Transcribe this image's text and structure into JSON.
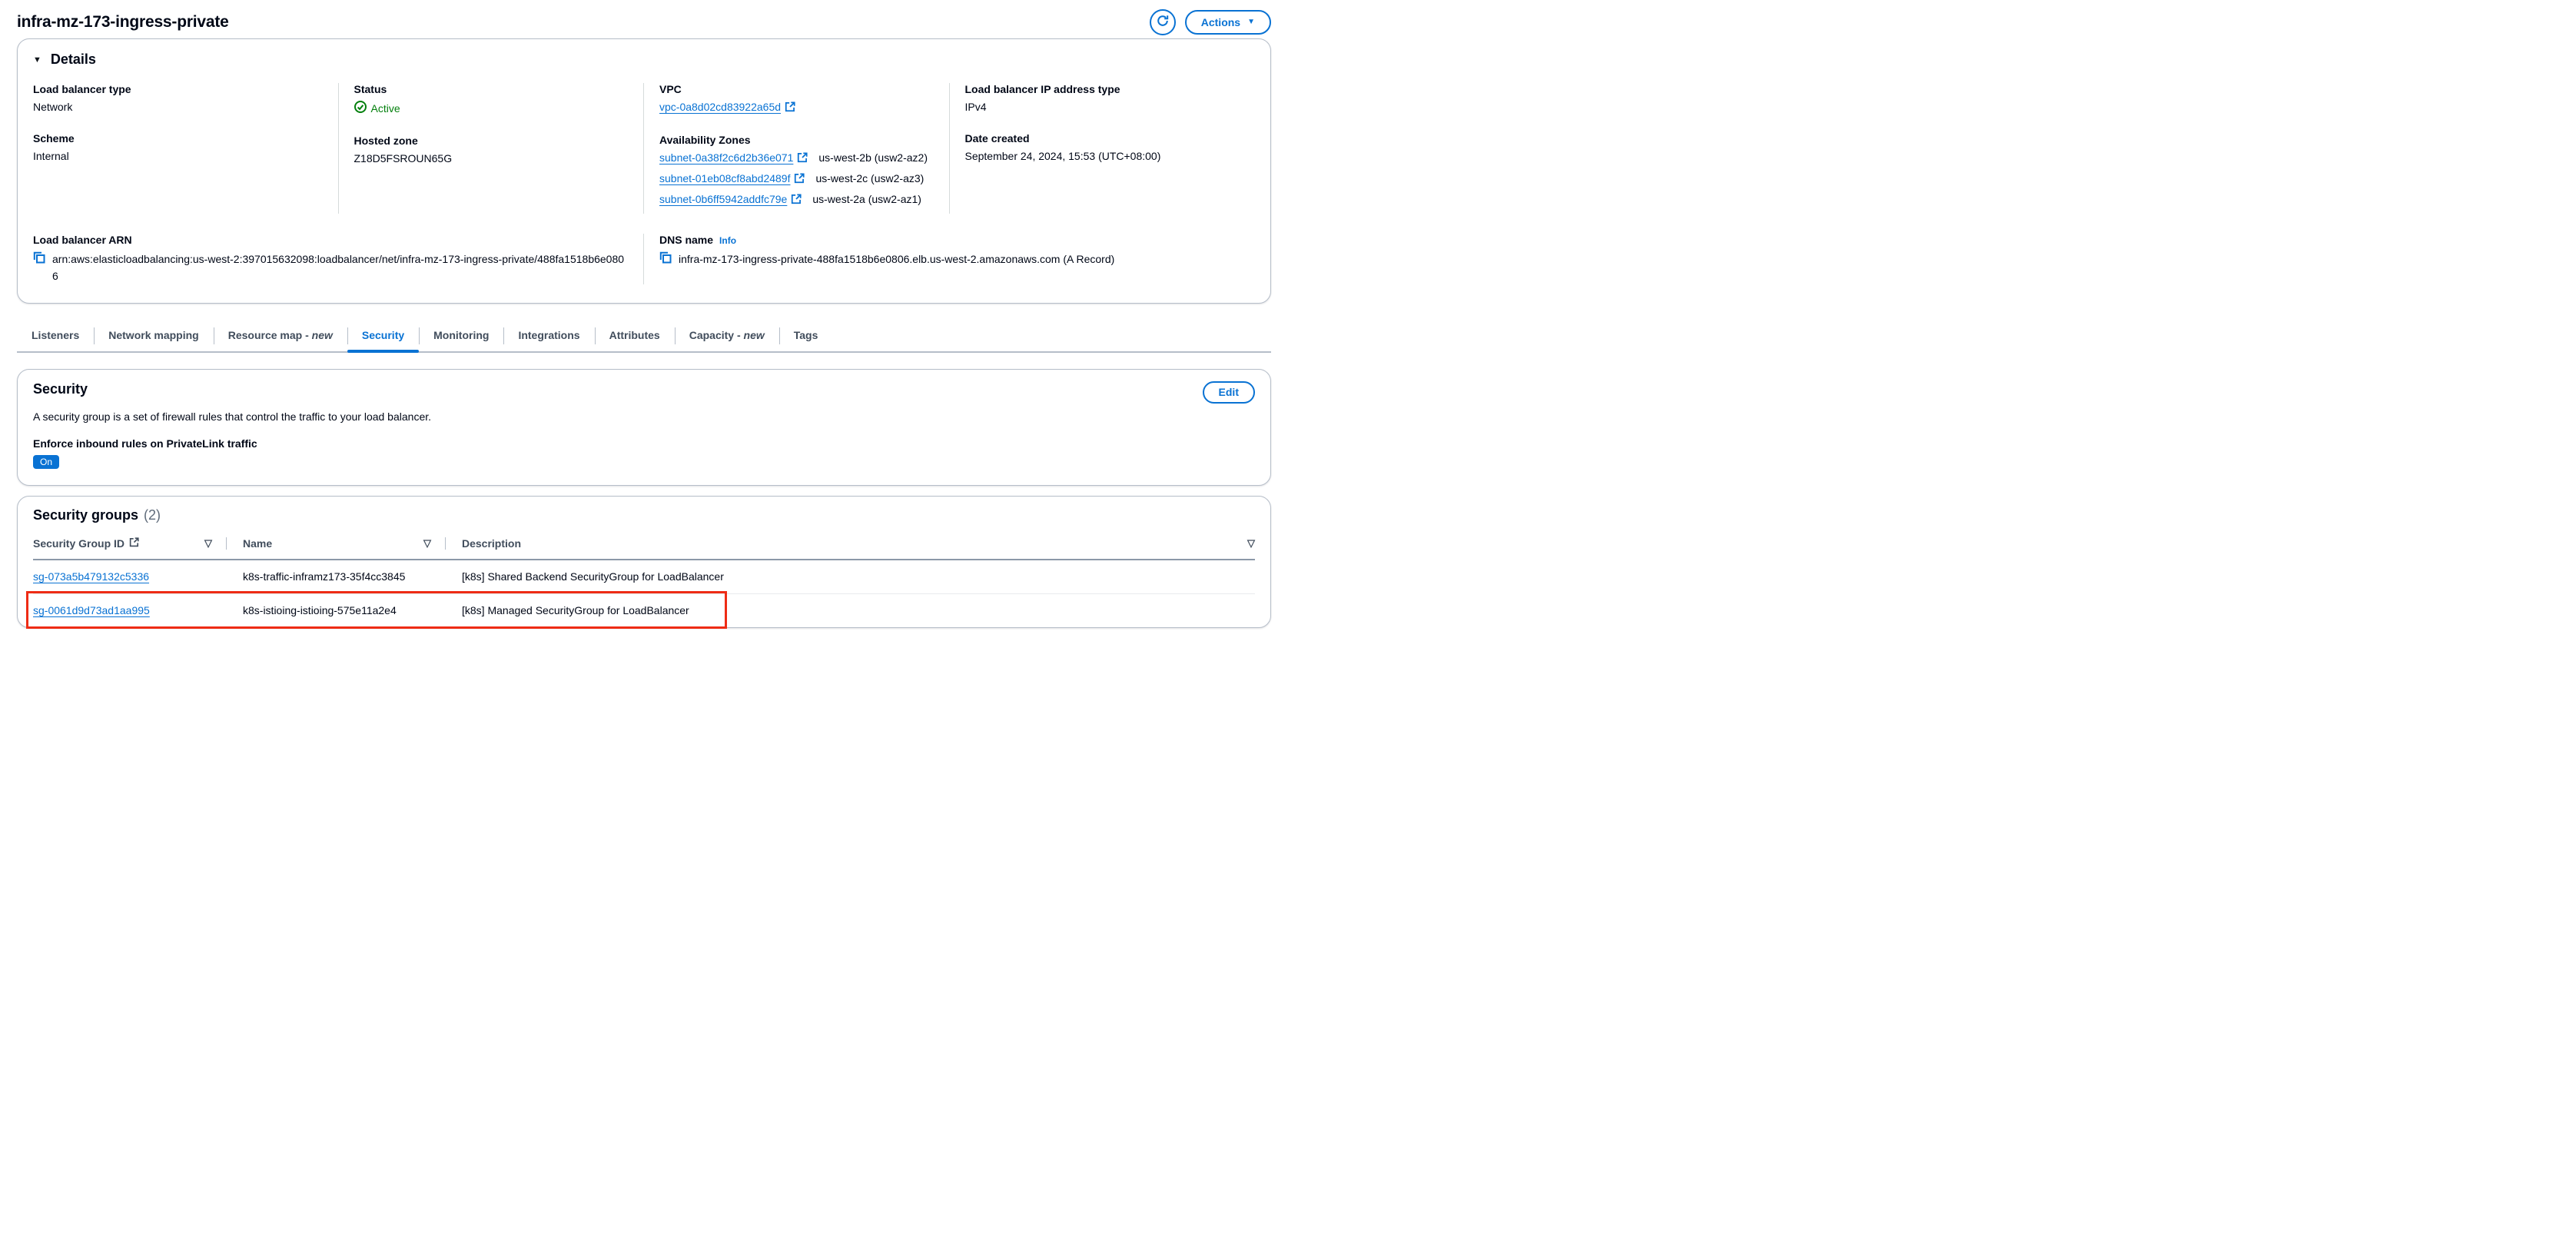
{
  "colors": {
    "accent": "#0972d3",
    "status_green": "#037f0c",
    "annotation_red": "#ee2c15"
  },
  "header": {
    "title": "infra-mz-173-ingress-private",
    "actions_label": "Actions"
  },
  "details": {
    "title": "Details",
    "lb_type_label": "Load balancer type",
    "lb_type_value": "Network",
    "scheme_label": "Scheme",
    "scheme_value": "Internal",
    "status_label": "Status",
    "status_value": "Active",
    "hosted_zone_label": "Hosted zone",
    "hosted_zone_value": "Z18D5FSROUN65G",
    "vpc_label": "VPC",
    "vpc_value": "vpc-0a8d02cd83922a65d",
    "az_label": "Availability Zones",
    "azs": [
      {
        "subnet": "subnet-0a38f2c6d2b36e071",
        "zone": "us-west-2b (usw2-az2)"
      },
      {
        "subnet": "subnet-01eb08cf8abd2489f",
        "zone": "us-west-2c (usw2-az3)"
      },
      {
        "subnet": "subnet-0b6ff5942addfc79e",
        "zone": "us-west-2a (usw2-az1)"
      }
    ],
    "ip_type_label": "Load balancer IP address type",
    "ip_type_value": "IPv4",
    "date_label": "Date created",
    "date_value": "September 24, 2024, 15:53 (UTC+08:00)",
    "arn_label": "Load balancer ARN",
    "arn_value": "arn:aws:elasticloadbalancing:us-west-2:397015632098:loadbalancer/net/infra-mz-173-ingress-private/488fa1518b6e0806",
    "dns_label": "DNS name",
    "dns_info": "Info",
    "dns_value": "infra-mz-173-ingress-private-488fa1518b6e0806.elb.us-west-2.amazonaws.com (A Record)"
  },
  "tabs": [
    {
      "label": "Listeners",
      "suffix": ""
    },
    {
      "label": "Network mapping",
      "suffix": ""
    },
    {
      "label": "Resource map - ",
      "suffix": "new"
    },
    {
      "label": "Security",
      "suffix": ""
    },
    {
      "label": "Monitoring",
      "suffix": ""
    },
    {
      "label": "Integrations",
      "suffix": ""
    },
    {
      "label": "Attributes",
      "suffix": ""
    },
    {
      "label": "Capacity - ",
      "suffix": "new"
    },
    {
      "label": "Tags",
      "suffix": ""
    }
  ],
  "security": {
    "title": "Security",
    "edit_label": "Edit",
    "description": "A security group is a set of firewall rules that control the traffic to your load balancer.",
    "enforce_label": "Enforce inbound rules on PrivateLink traffic",
    "enforce_value": "On"
  },
  "security_groups": {
    "title": "Security groups",
    "count": "(2)",
    "columns": [
      "Security Group ID",
      "Name",
      "Description"
    ],
    "rows": [
      {
        "id": "sg-073a5b479132c5336",
        "name": "k8s-traffic-inframz173-35f4cc3845",
        "description": "[k8s] Shared Backend SecurityGroup for LoadBalancer"
      },
      {
        "id": "sg-0061d9d73ad1aa995",
        "name": "k8s-istioing-istioing-575e11a2e4",
        "description": "[k8s] Managed SecurityGroup for LoadBalancer"
      }
    ]
  }
}
